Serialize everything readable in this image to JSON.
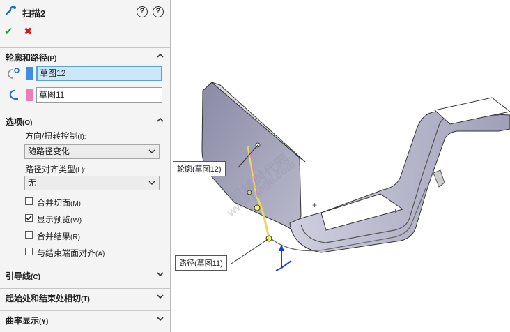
{
  "title": "扫描2",
  "sections": {
    "profile_path": {
      "label": "轮廓和路径",
      "key": "(P)"
    },
    "options": {
      "label": "选项",
      "key": "(O)"
    },
    "guide": {
      "label": "引导线",
      "key": "(C)"
    },
    "tangency": {
      "label": "起始处和结束处相切",
      "key": "(T)"
    },
    "curvature": {
      "label": "曲率显示",
      "key": "(Y)"
    }
  },
  "profile_field": {
    "value": "草图12",
    "color": "#3d8fe3"
  },
  "path_field": {
    "value": "草图11",
    "color": "#e87db9"
  },
  "options": {
    "orient_label": "方向/扭转控制",
    "orient_key": "(I):",
    "orient_value": "随路径变化",
    "align_label": "路径对齐类型",
    "align_key": "(L):",
    "align_value": "无",
    "checkboxes": [
      {
        "label": "合并切面",
        "key": "(M)",
        "checked": false
      },
      {
        "label": "显示预览",
        "key": "(W)",
        "checked": true
      },
      {
        "label": "合并结果",
        "key": "(R)",
        "checked": false
      },
      {
        "label": "与结束端面对齐",
        "key": "(A)",
        "checked": false
      }
    ]
  },
  "callouts": {
    "profile": "轮廓(草图12)",
    "path": "路径(草图11)"
  },
  "watermark": {
    "line1": "机械时代网",
    "line2": "www.jxage.com"
  }
}
